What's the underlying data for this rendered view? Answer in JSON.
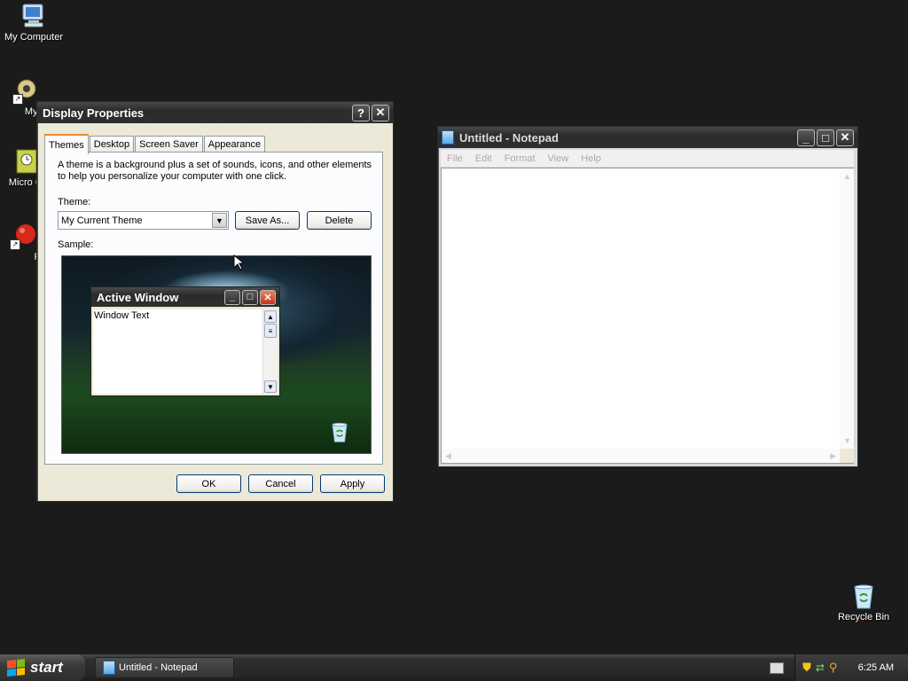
{
  "desktop": {
    "icons": [
      {
        "label": "My Computer"
      },
      {
        "label": "MyPa"
      },
      {
        "label": "Micro Outl"
      },
      {
        "label": "Pe"
      },
      {
        "label": "Recycle Bin"
      }
    ]
  },
  "display_properties": {
    "title": "Display Properties",
    "tabs": [
      "Themes",
      "Desktop",
      "Screen Saver",
      "Appearance"
    ],
    "description": "A theme is a background plus a set of sounds, icons, and other elements to help you personalize your computer with one click.",
    "theme_label": "Theme:",
    "theme_value": "My Current Theme",
    "save_as_label": "Save As...",
    "delete_label": "Delete",
    "sample_label": "Sample:",
    "sample_window_title": "Active Window",
    "sample_window_text": "Window Text",
    "ok_label": "OK",
    "cancel_label": "Cancel",
    "apply_label": "Apply"
  },
  "notepad": {
    "title": "Untitled - Notepad",
    "menu": [
      "File",
      "Edit",
      "Format",
      "View",
      "Help"
    ],
    "content": ""
  },
  "taskbar": {
    "start_label": "start",
    "task_label": "Untitled - Notepad",
    "clock": "6:25 AM"
  },
  "colors": {
    "desktop_bg": "#1b1b1b",
    "dialog_bg": "#ece9d8",
    "tab_accent": "#e68b2c",
    "button_border": "#003c74"
  }
}
